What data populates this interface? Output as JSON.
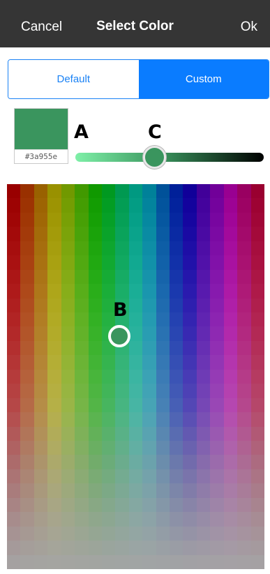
{
  "nav": {
    "cancel_label": "Cancel",
    "title": "Select Color",
    "ok_label": "Ok",
    "background": "#353535"
  },
  "tabs": {
    "default_label": "Default",
    "custom_label": "Custom",
    "selected": "Custom",
    "accent": "#0a7cff"
  },
  "current_color": {
    "hex_label": "#3a955e",
    "value": "#3a955e"
  },
  "annotations": {
    "a": "A",
    "b": "B",
    "c": "C"
  },
  "brightness_slider": {
    "start_color": "#7ff0a8",
    "mid_color": "#3a955e",
    "end_color": "#000000",
    "level": 0.43
  },
  "palette": {
    "columns": 19,
    "rows": 27,
    "saturation_top": 1.0,
    "saturation_bottom": 0.02,
    "selected_hue_fraction": 0.4,
    "selected_row_fraction": 0.4
  },
  "icons": {
    "slider_thumb": "circle-thumb",
    "palette_picker": "ring-picker"
  }
}
